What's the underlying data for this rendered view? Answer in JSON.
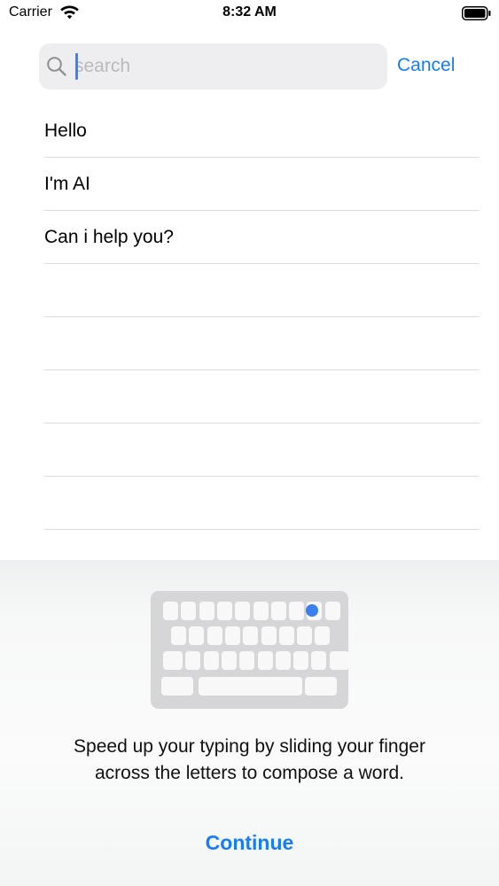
{
  "status_bar": {
    "carrier": "Carrier",
    "time": "8:32 AM",
    "icons": [
      "wifi-icon",
      "battery-icon"
    ]
  },
  "search": {
    "placeholder": "search",
    "value": "",
    "icon": "search-icon",
    "cancel_label": "Cancel"
  },
  "list": {
    "items": [
      "Hello",
      "I'm AI",
      "Can i help you?",
      "",
      "",
      "",
      "",
      ""
    ]
  },
  "keyboard_onboarding": {
    "illustration": "swipe-keyboard-icon",
    "message": "Speed up your typing by sliding your finger across the letters to compose a word.",
    "continue_label": "Continue"
  },
  "colors": {
    "accent": "#1a7cf5",
    "search_field_bg": "#eeeef0",
    "separator": "#dcdcde",
    "keyboard_bg": "#d6d6d8",
    "swipe_dot": "#3b7ff0"
  }
}
